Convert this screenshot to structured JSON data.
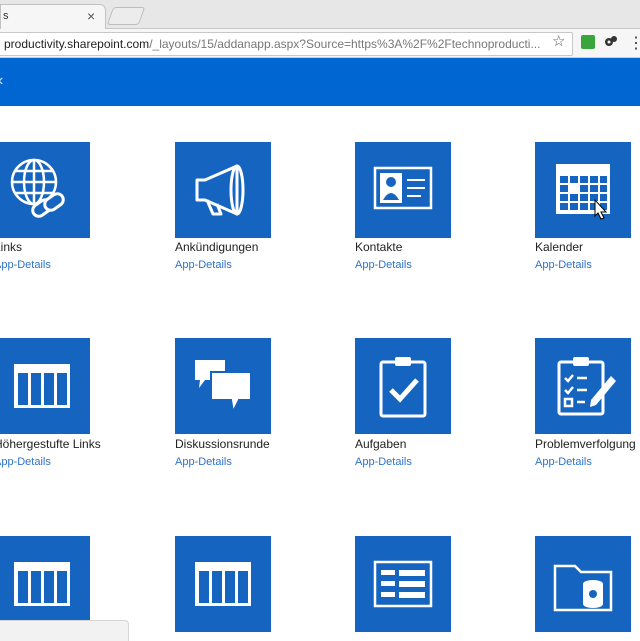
{
  "browser": {
    "tab_title": "s",
    "tab_close": "×",
    "url_host": "productivity.sharepoint.com",
    "url_path": "/_layouts/15/addanapp.aspx?Source=https%3A%2F%2Ftechnoproducti...",
    "star": "☆",
    "menu": "⋮"
  },
  "suitebar": {
    "mark": "‹",
    "color": "#0067d2"
  },
  "apps": [
    {
      "name": "Links",
      "link": "App-Details",
      "icon": "globe-link-icon"
    },
    {
      "name": "Ankündigungen",
      "link": "App-Details",
      "icon": "megaphone-icon"
    },
    {
      "name": "Kontakte",
      "link": "App-Details",
      "icon": "contact-card-icon"
    },
    {
      "name": "Kalender",
      "link": "App-Details",
      "icon": "calendar-icon"
    },
    {
      "name": "Höhergestufte Links",
      "link": "App-Details",
      "icon": "list-table-icon"
    },
    {
      "name": "Diskussionsrunde",
      "link": "App-Details",
      "icon": "discussion-bubbles-icon"
    },
    {
      "name": "Aufgaben",
      "link": "App-Details",
      "icon": "task-clipboard-icon"
    },
    {
      "name": "Problemverfolgung",
      "link": "App-Details",
      "icon": "issue-tracking-icon"
    },
    {
      "name": "",
      "link": "",
      "icon": "list-table-icon"
    },
    {
      "name": "",
      "link": "",
      "icon": "list-table-icon"
    },
    {
      "name": "",
      "link": "",
      "icon": "form-list-icon"
    },
    {
      "name": "",
      "link": "",
      "icon": "folder-database-icon"
    }
  ],
  "tile_color": "#1565c0",
  "link_color": "#2e73c9"
}
